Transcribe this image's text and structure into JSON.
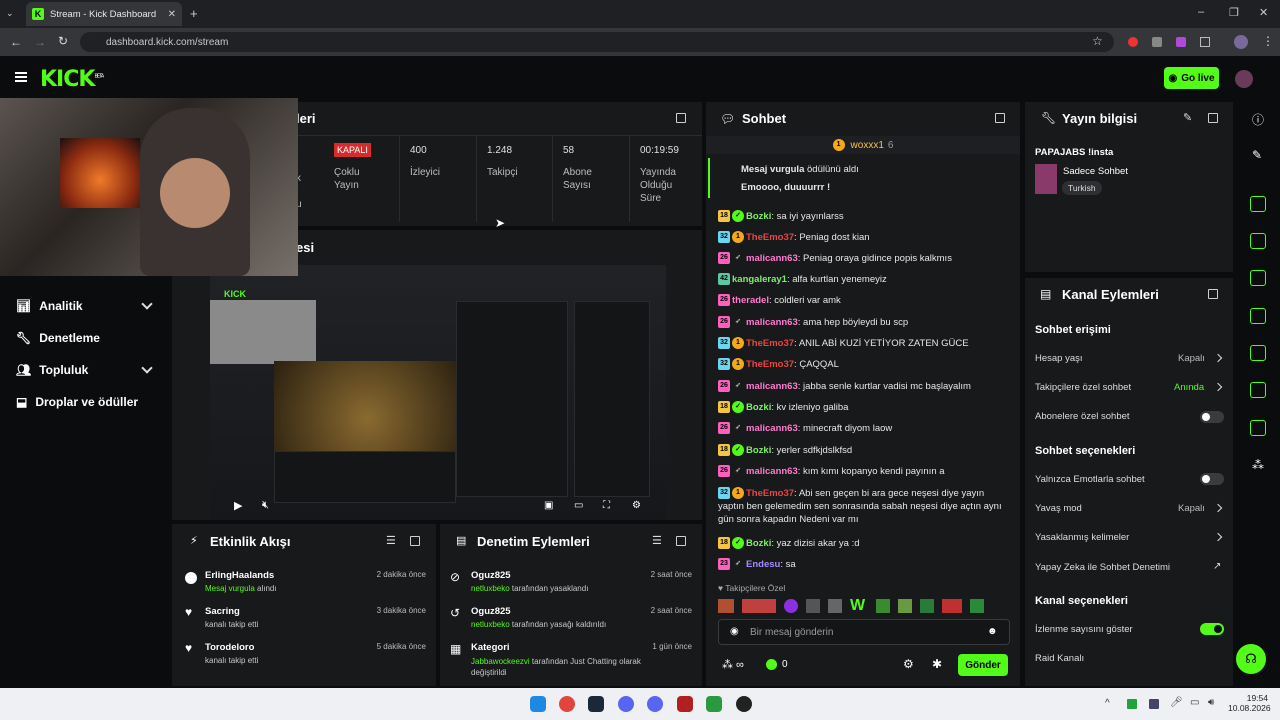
{
  "browser": {
    "tab_title": "Stream - Kick Dashboard",
    "url": "dashboard.kick.com/stream"
  },
  "header": {
    "logo": "KICK",
    "logo_beta": "BETA",
    "go_live": "Go live"
  },
  "stats_panel": {
    "title_fragment": "leri",
    "items": [
      {
        "value": "KAPALI",
        "label": "Çoklu Yayın"
      },
      {
        "value": "400",
        "label": "İzleyici"
      },
      {
        "value": "1.248",
        "label": "Takipçi"
      },
      {
        "value": "58",
        "label": "Abone Sayısı"
      },
      {
        "value": "00:19:59",
        "label": "Yayında Olduğu Süre"
      }
    ],
    "left_frag_a": "k",
    "left_frag_b": "u"
  },
  "preview": {
    "title_fragment": "esi"
  },
  "nav": {
    "items": [
      {
        "label": "Analitik"
      },
      {
        "label": "Denetleme"
      },
      {
        "label": "Topluluk"
      },
      {
        "label": "Droplar ve ödüller"
      }
    ]
  },
  "activity": {
    "title": "Etkinlik Akışı",
    "items": [
      {
        "name": "ErlingHaalands",
        "sub_hl": "Mesaj vurgula",
        "sub": " alındı",
        "time": "2 dakika önce"
      },
      {
        "name": "Sacring",
        "sub_hl": "",
        "sub": "kanalı takip etti",
        "time": "3 dakika önce"
      },
      {
        "name": "Torodeloro",
        "sub_hl": "",
        "sub": "kanalı takip etti",
        "time": "5 dakika önce"
      }
    ]
  },
  "moderation": {
    "title": "Denetim Eylemleri",
    "items": [
      {
        "name": "Oguz825",
        "sub_hl": "netluxbeko",
        "sub": " tarafından yasaklandı",
        "time": "2 saat önce"
      },
      {
        "name": "Oguz825",
        "sub_hl": "netluxbeko",
        "sub": " tarafından yasağı kaldırıldı",
        "time": "2 saat önce"
      },
      {
        "name": "Kategori",
        "sub_hl": "Jabbawockeezvi",
        "sub": " tarafından Just Chatting olarak değiştirildi",
        "time": "1 gün önce"
      }
    ]
  },
  "chat": {
    "title": "Sohbet",
    "pinned_user": "woxxx1",
    "pinned_count": "6",
    "reward_title": "Mesaj vurgula",
    "reward_suffix": " ödülünü aldı",
    "reward_msg": "Emoooo, duuuurrr !",
    "messages": [
      {
        "badges": [
          "18",
          "ver"
        ],
        "user": "Bozki",
        "color": "#7df06a",
        "text": "sa iyi yayınlarss"
      },
      {
        "badges": [
          "32",
          "sub"
        ],
        "user": "TheEmo37",
        "color": "#e84545",
        "text": "Peniag dost kian"
      },
      {
        "badges": [
          "26",
          "wing"
        ],
        "user": "malicann63",
        "color": "#ff7ad0",
        "text": "Peniag oraya gidince popis kalkmıs"
      },
      {
        "badges": [
          "42"
        ],
        "user": "kangaleray1",
        "color": "#7df06a",
        "text": "alfa kurtlan yenemeyiz"
      },
      {
        "badges": [
          "26"
        ],
        "user": "theradel",
        "color": "#ff7ad0",
        "text": "coldleri var amk"
      },
      {
        "badges": [
          "26",
          "wing"
        ],
        "user": "malicann63",
        "color": "#ff7ad0",
        "text": "ama hep böyleydi bu scp"
      },
      {
        "badges": [
          "32",
          "sub"
        ],
        "user": "TheEmo37",
        "color": "#e84545",
        "text": "ANIL ABİ KUZİ YETİYOR ZATEN GÜCE"
      },
      {
        "badges": [
          "32",
          "sub"
        ],
        "user": "TheEmo37",
        "color": "#e84545",
        "text": "ÇAQQAL"
      },
      {
        "badges": [
          "26",
          "wing"
        ],
        "user": "malicann63",
        "color": "#ff7ad0",
        "text": "jabba senle kurtlar vadisi mc başlayalım"
      },
      {
        "badges": [
          "18",
          "ver"
        ],
        "user": "Bozki",
        "color": "#7df06a",
        "text": "kv izleniyo galiba"
      },
      {
        "badges": [
          "26",
          "wing"
        ],
        "user": "malicann63",
        "color": "#ff7ad0",
        "text": "minecraft diyom laow"
      },
      {
        "badges": [
          "18",
          "ver"
        ],
        "user": "Bozki",
        "color": "#7df06a",
        "text": "yerler sdfkjdslkfsd"
      },
      {
        "badges": [
          "26",
          "wing"
        ],
        "user": "malicann63",
        "color": "#ff7ad0",
        "text": "kım kımı kopanyo kendi payının a"
      },
      {
        "badges": [
          "32",
          "sub"
        ],
        "user": "TheEmo37",
        "color": "#e84545",
        "text": "Abi sen geçen bi ara gece neşesi diye yayın yaptın ben gelemedim sen sonrasında sabah neşesi diye açtın aynı gün sonra kapadın Nedeni var mı"
      },
      {
        "badges": [
          "18",
          "ver"
        ],
        "user": "Bozki",
        "color": "#7df06a",
        "text": "yaz dizisi akar ya :d"
      },
      {
        "badges": [
          "23",
          "wing"
        ],
        "user": "Endesu",
        "color": "#a68bff",
        "text": "sa"
      }
    ],
    "followers_only": "Takipçilere Özel",
    "input_placeholder": "Bir mesaj gönderin",
    "send": "Gönder",
    "points": "0"
  },
  "stream_info": {
    "title": "Yayın bilgisi",
    "stream_title": "PAPAJABS !insta",
    "category": "Sadece Sohbet",
    "language": "Turkish"
  },
  "channel_actions": {
    "title": "Kanal Eylemleri",
    "chat_access": "Sohbet erişimi",
    "account_age": {
      "label": "Hesap yaşı",
      "value": "Kapalı"
    },
    "followers_chat": {
      "label": "Takipçilere özel sohbet",
      "value": "Anında"
    },
    "subs_chat": {
      "label": "Abonelere özel sohbet"
    },
    "chat_options": "Sohbet seçenekleri",
    "emote_only": {
      "label": "Yalnızca Emotlarla sohbet"
    },
    "slow_mode": {
      "label": "Yavaş mod",
      "value": "Kapalı"
    },
    "banned_words": {
      "label": "Yasaklanmış kelimeler"
    },
    "ai_moderation": {
      "label": "Yapay Zeka ile Sohbet Denetimi"
    },
    "channel_options": "Kanal seçenekleri",
    "show_viewers": {
      "label": "İzlenme sayısını göster"
    },
    "raid": {
      "label": "Raid Kanalı"
    }
  },
  "taskbar": {
    "time": "19:54",
    "date": "10.08.2026"
  }
}
